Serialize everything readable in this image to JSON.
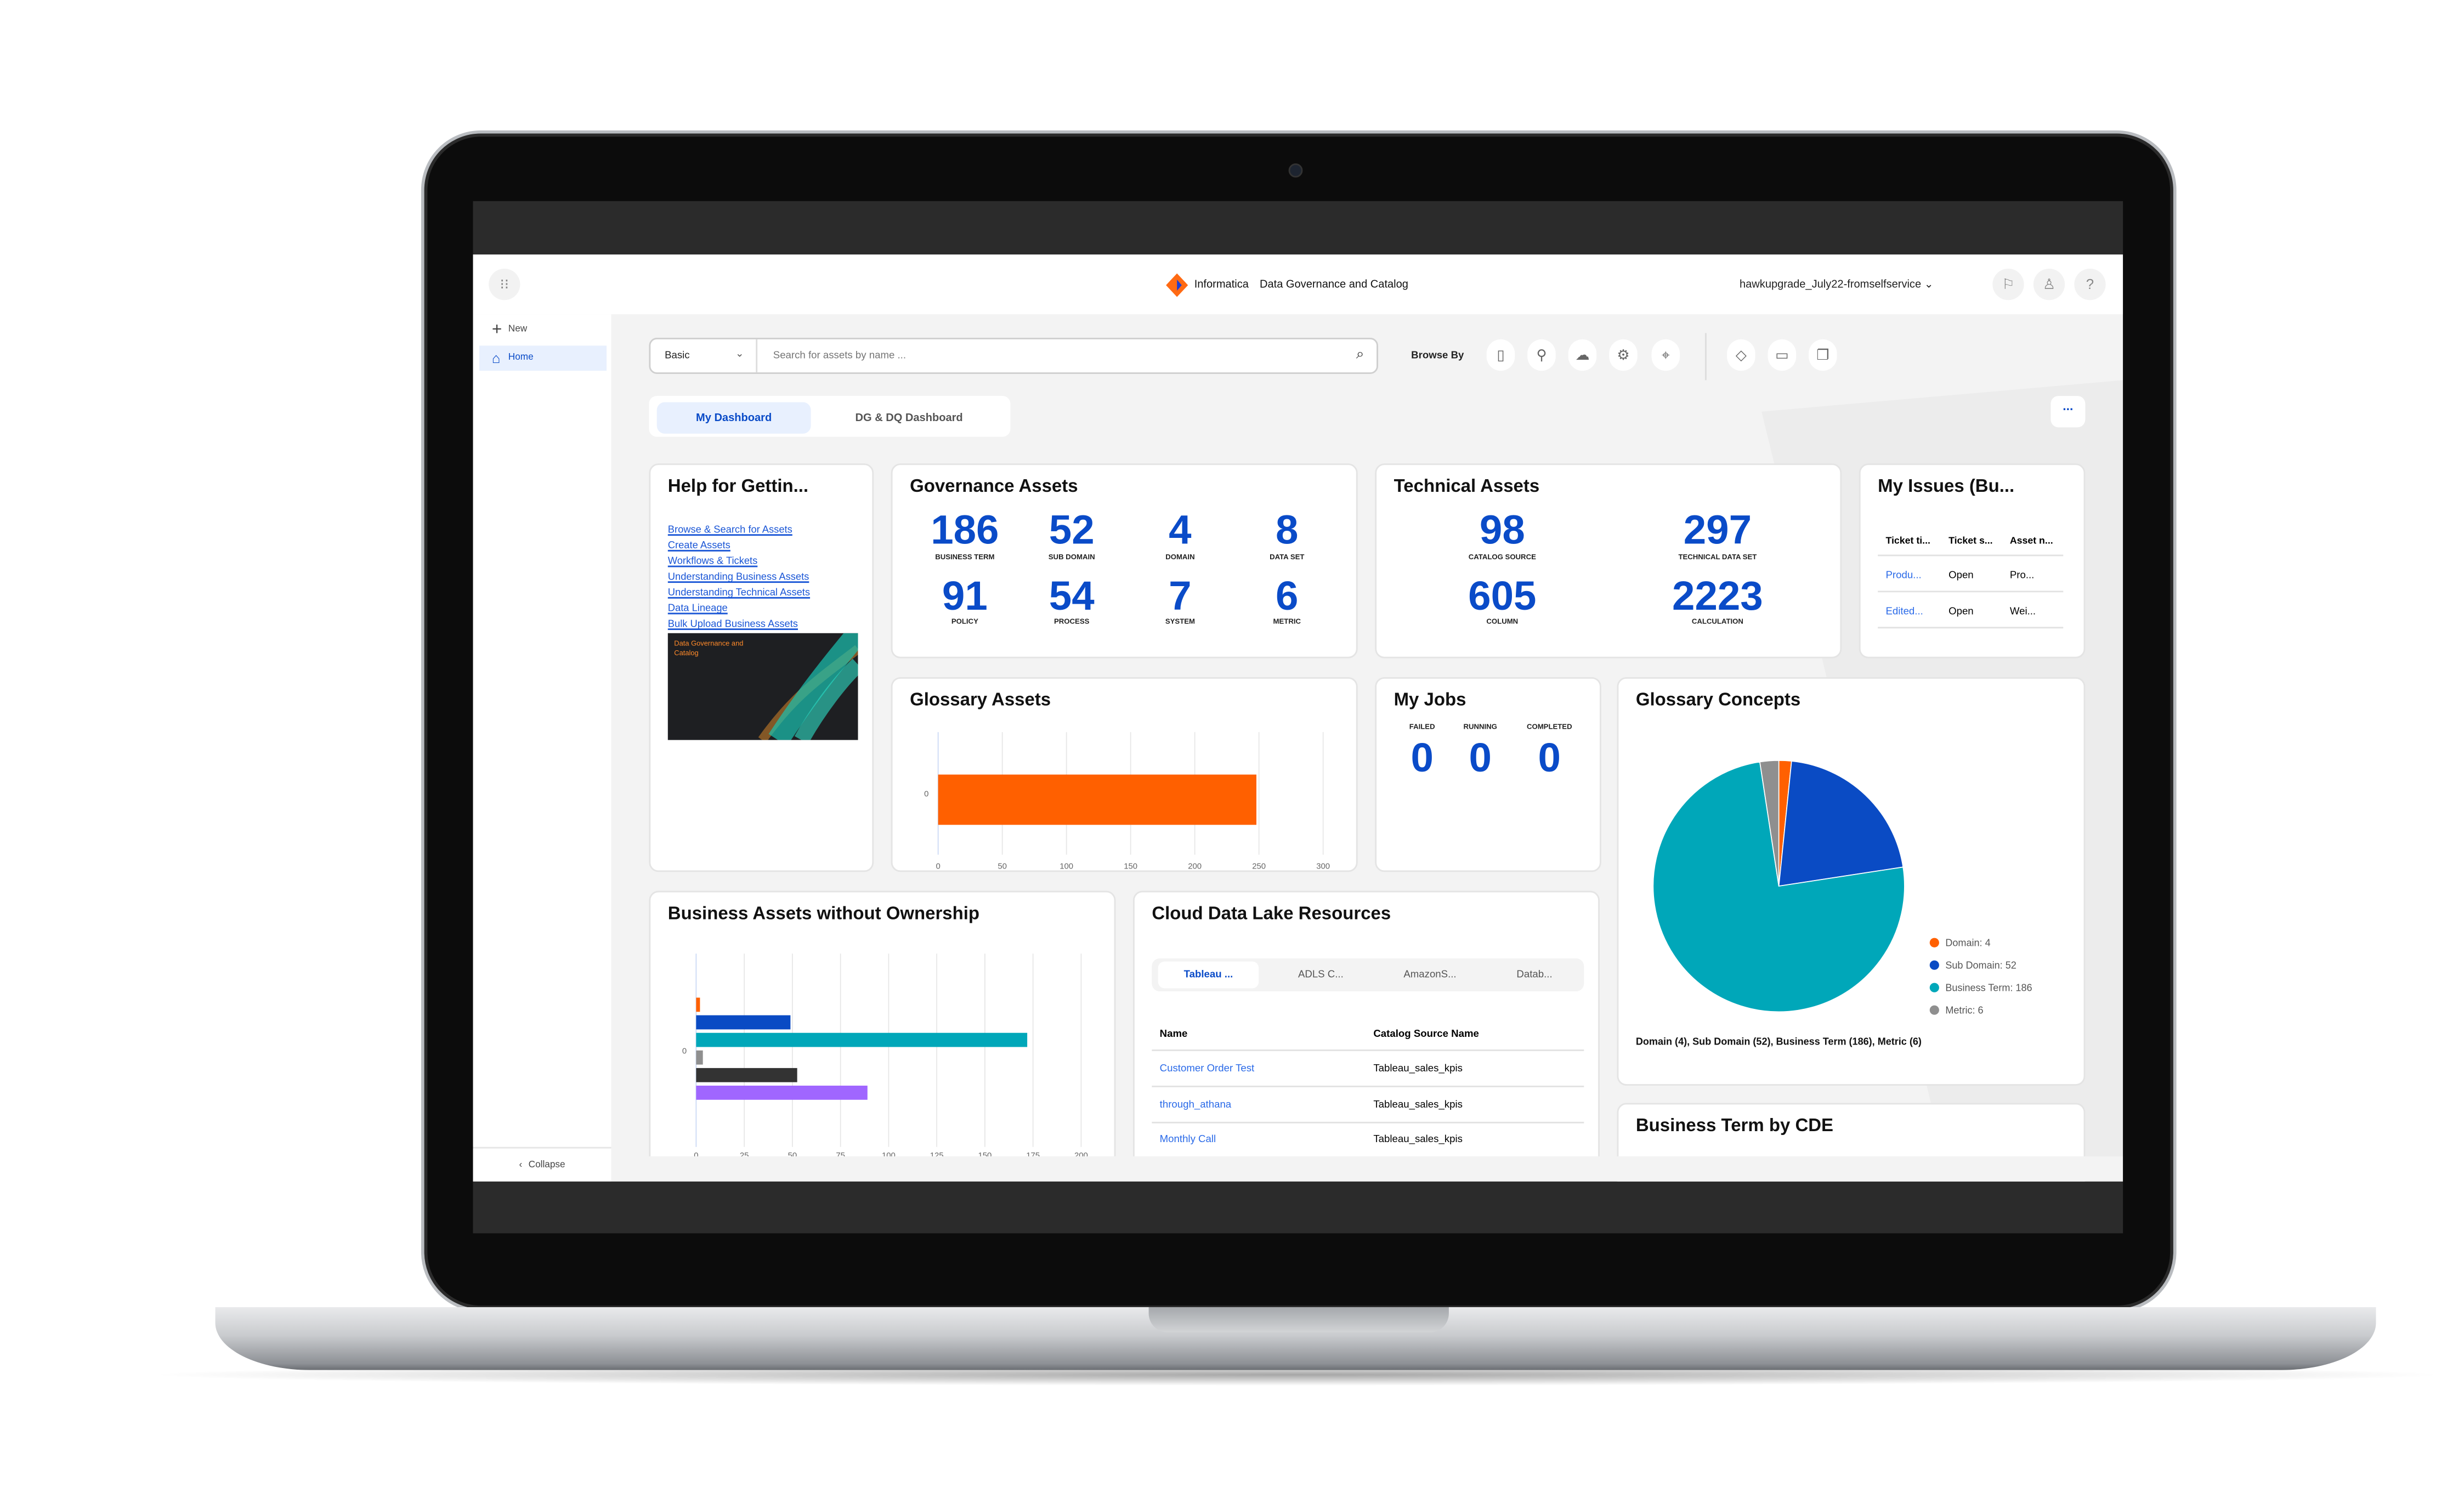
{
  "header": {
    "brand": "Informatica",
    "product": "Data Governance and Catalog",
    "user": "hawkupgrade_July22-fromselfservice",
    "icons": [
      "grid-icon",
      "flag-icon",
      "user-icon",
      "help-icon"
    ]
  },
  "sidebar": {
    "new_label": "New",
    "home_label": "Home",
    "collapse_label": "Collapse"
  },
  "search": {
    "mode": "Basic",
    "placeholder": "Search for assets by name ...",
    "browse_by": "Browse By"
  },
  "tabs": [
    {
      "label": "My Dashboard",
      "active": true
    },
    {
      "label": "DG & DQ Dashboard",
      "active": false
    }
  ],
  "more_label": "...",
  "help": {
    "title": "Help for Gettin...",
    "links": [
      "Browse & Search for Assets",
      "Create Assets",
      "Workflows & Tickets",
      "Understanding Business Assets",
      "Understanding Technical Assets",
      "Data Lineage",
      "Bulk Upload Business Assets"
    ],
    "image_text": "Data Governance and Catalog"
  },
  "governance": {
    "title": "Governance Assets",
    "items": [
      {
        "value": "186",
        "label": "BUSINESS TERM"
      },
      {
        "value": "52",
        "label": "SUB DOMAIN"
      },
      {
        "value": "4",
        "label": "DOMAIN"
      },
      {
        "value": "8",
        "label": "DATA SET"
      },
      {
        "value": "91",
        "label": "POLICY"
      },
      {
        "value": "54",
        "label": "PROCESS"
      },
      {
        "value": "7",
        "label": "SYSTEM"
      },
      {
        "value": "6",
        "label": "METRIC"
      }
    ]
  },
  "technical": {
    "title": "Technical Assets",
    "items": [
      {
        "value": "98",
        "label": "CATALOG SOURCE"
      },
      {
        "value": "297",
        "label": "TECHNICAL DATA SET"
      },
      {
        "value": "605",
        "label": "COLUMN"
      },
      {
        "value": "2223",
        "label": "CALCULATION"
      }
    ]
  },
  "issues": {
    "title": "My Issues (Bu...",
    "columns": [
      "Ticket ti...",
      "Ticket s...",
      "Asset n..."
    ],
    "rows": [
      [
        "Produ...",
        "Open",
        "Pro..."
      ],
      [
        "Edited...",
        "Open",
        "Wei..."
      ]
    ]
  },
  "jobs": {
    "title": "My Jobs",
    "items": [
      {
        "label": "FAILED",
        "value": "0"
      },
      {
        "label": "RUNNING",
        "value": "0"
      },
      {
        "label": "COMPLETED",
        "value": "0"
      }
    ]
  },
  "glossary_assets": {
    "title": "Glossary Assets"
  },
  "glossary_concepts": {
    "title": "Glossary Concepts",
    "summary": "Domain (4), Sub Domain (52), Business Term (186), Metric (6)"
  },
  "ownership": {
    "title": "Business Assets without Ownership"
  },
  "cloud": {
    "title": "Cloud Data Lake Resources",
    "tabs": [
      "Tableau ...",
      "ADLS C...",
      "AmazonS...",
      "Datab..."
    ],
    "columns": [
      "Name",
      "Catalog Source Name"
    ],
    "rows": [
      [
        "Customer Order Test",
        "Tableau_sales_kpis"
      ],
      [
        "through_athana",
        "Tableau_sales_kpis"
      ],
      [
        "Monthly Call",
        "Tableau_sales_kpis"
      ]
    ]
  },
  "cde": {
    "title": "Business Term by CDE"
  },
  "colors": {
    "accent": "#0a4bc8",
    "orange": "#ff6000",
    "teal": "#00a7b9",
    "gray": "#8f8f8f",
    "dark": "#333333",
    "purple": "#a066ff"
  },
  "chart_data": [
    {
      "type": "bar",
      "orientation": "horizontal",
      "categories": [
        "0"
      ],
      "values": [
        248
      ],
      "xlim": [
        0,
        300
      ],
      "xticks": [
        0,
        50,
        100,
        150,
        200,
        250,
        300
      ],
      "colors": [
        "#ff6000"
      ],
      "grid": true
    },
    {
      "type": "bar",
      "orientation": "horizontal",
      "categories": [
        "0"
      ],
      "series": [
        {
          "values": [
            2
          ],
          "color": "#ff6000"
        },
        {
          "values": [
            49
          ],
          "color": "#0a4bc4"
        },
        {
          "values": [
            172
          ],
          "color": "#00a7b9"
        },
        {
          "values": [
            3.5
          ],
          "color": "#8f8f8f"
        },
        {
          "values": [
            52.5
          ],
          "color": "#333333"
        },
        {
          "values": [
            89
          ],
          "color": "#a066ff"
        }
      ],
      "xlim": [
        0,
        200
      ],
      "xticks": [
        0,
        25,
        50,
        75,
        100,
        125,
        150,
        175,
        200
      ],
      "grid": true
    },
    {
      "type": "pie",
      "slices": [
        {
          "label": "Domain",
          "value": 4,
          "legend": "Domain: 4",
          "color": "#ff6000"
        },
        {
          "label": "Sub Domain",
          "value": 52,
          "legend": "Sub Domain: 52",
          "color": "#0a4bc4"
        },
        {
          "label": "Business Term",
          "value": 186,
          "legend": "Business Term: 186",
          "color": "#00a7b9"
        },
        {
          "label": "Metric",
          "value": 6,
          "legend": "Metric: 6",
          "color": "#8f8f8f"
        }
      ],
      "legend": "right-bottom"
    }
  ]
}
